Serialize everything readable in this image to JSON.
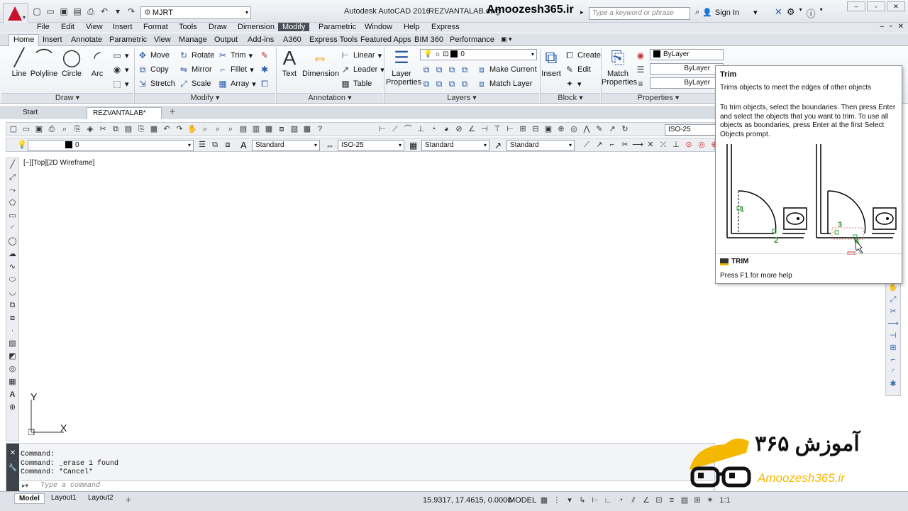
{
  "window": {
    "app_title": "Autodesk AutoCAD 2016",
    "file_title": "REZVANTALAB.dwg",
    "brand_overlay": "Amoozesh365.ir",
    "workspace": "MJRT",
    "search_placeholder": "Type a keyword or phrase",
    "sign_in": "Sign In"
  },
  "menu": [
    "File",
    "Edit",
    "View",
    "Insert",
    "Format",
    "Tools",
    "Draw",
    "Dimension",
    "Modify",
    "Parametric",
    "Window",
    "Help",
    "Express"
  ],
  "ribbon_tabs": [
    "Home",
    "Insert",
    "Annotate",
    "Parametric",
    "View",
    "Manage",
    "Output",
    "Add-ins",
    "A360",
    "Express Tools",
    "Featured Apps",
    "BIM 360",
    "Performance"
  ],
  "ribbon": {
    "draw": {
      "title": "Draw",
      "line": "Line",
      "polyline": "Polyline",
      "circle": "Circle",
      "arc": "Arc"
    },
    "modify": {
      "title": "Modify",
      "move": "Move",
      "rotate": "Rotate",
      "trim": "Trim",
      "copy": "Copy",
      "mirror": "Mirror",
      "fillet": "Fillet",
      "stretch": "Stretch",
      "scale": "Scale",
      "array": "Array"
    },
    "annotation": {
      "title": "Annotation",
      "text": "Text",
      "dimension": "Dimension",
      "linear": "Linear",
      "leader": "Leader",
      "table": "Table"
    },
    "layers": {
      "title": "Layers",
      "layer_props_1": "Layer",
      "layer_props_2": "Properties",
      "current_layer": "0",
      "make_current": "Make Current",
      "match_layer": "Match Layer"
    },
    "block": {
      "title": "Block",
      "insert": "Insert",
      "create": "Create",
      "edit": "Edit"
    },
    "properties": {
      "title": "Properties",
      "match_1": "Match",
      "match_2": "Properties",
      "color": "ByLayer",
      "linetype": "ByLayer",
      "lineweight": "ByLayer"
    }
  },
  "doc_tabs": {
    "start": "Start",
    "current": "REZVANTALAB*"
  },
  "toolbars": {
    "dimstyle": "ISO-25",
    "layer": "0",
    "text_style": "Standard",
    "dim_style": "ISO-25",
    "table_style": "Standard",
    "mleader_style": "Standard"
  },
  "viewport_label": "[−][Top][2D Wireframe]",
  "ucs": {
    "x": "X",
    "y": "Y"
  },
  "command_history": [
    "Command:",
    "Command: _erase 1 found",
    "Command: *Cancel*"
  ],
  "command_placeholder": "Type a command",
  "layout_tabs": [
    "Model",
    "Layout1",
    "Layout2"
  ],
  "status": {
    "coords": "15.9317, 17.4615, 0.0000",
    "mode": "MODEL",
    "scale": "1:1"
  },
  "tooltip": {
    "title": "Trim",
    "short": "Trims objects to meet the edges of other objects",
    "long": "To trim objects, select the boundaries. Then press Enter and select the objects that you want to trim. To use all objects as boundaries, press Enter at the first Select Objects prompt.",
    "command": "TRIM",
    "help": "Press F1 for more help",
    "labels": [
      "1",
      "2",
      "3",
      "4"
    ]
  },
  "watermark": {
    "persian": "آموزش ۳۶۵",
    "latin": "Amoozesh365.ir"
  },
  "colors": {
    "accent": "#c8102e",
    "active_menu": "#4a5058",
    "tooltip_green": "#2ca02c",
    "watermark_yellow": "#f5b800"
  }
}
